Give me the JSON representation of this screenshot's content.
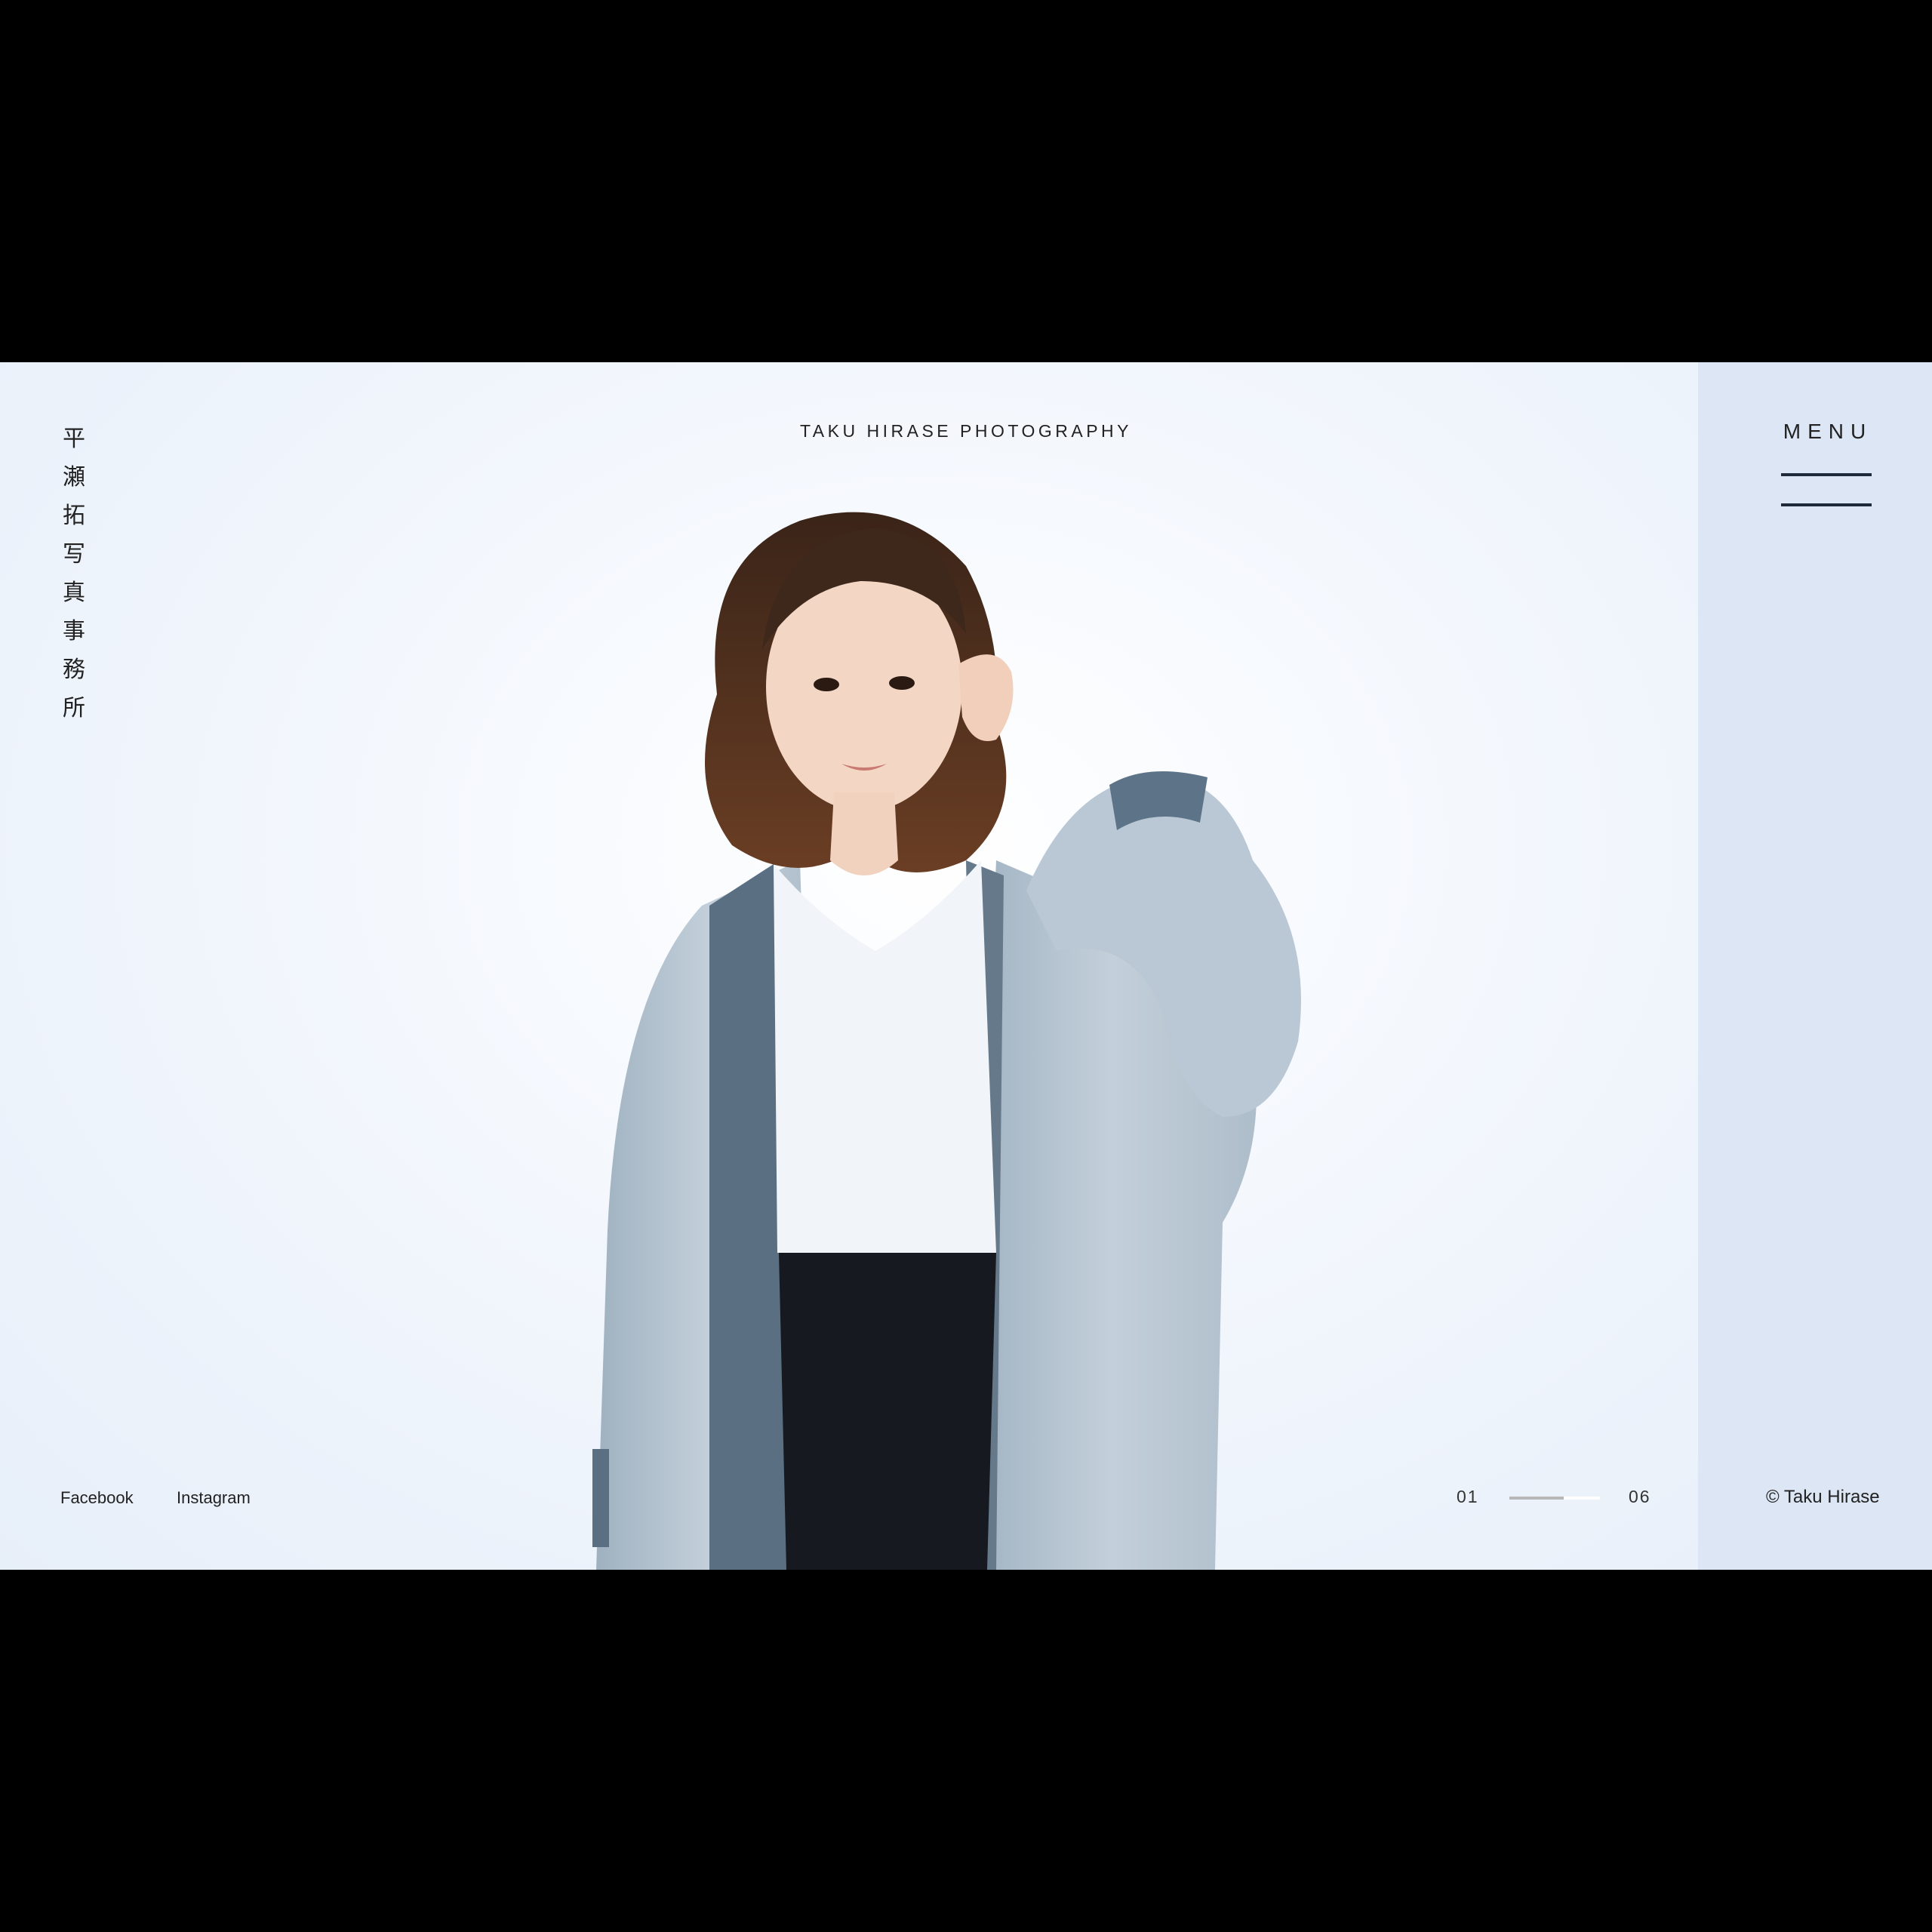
{
  "brand": {
    "logo_vertical": [
      "平",
      "瀬",
      "拓",
      "写",
      "真",
      "事",
      "務",
      "所"
    ],
    "site_title": "TAKU HIRASE PHOTOGRAPHY"
  },
  "menu": {
    "label": "MENU",
    "icon": "hamburger-icon"
  },
  "social_links": [
    {
      "label": "Facebook"
    },
    {
      "label": "Instagram"
    }
  ],
  "slider": {
    "current": "01",
    "total": "06",
    "progress": 0.6
  },
  "footer": {
    "copyright": "© Taku Hirase"
  },
  "colors": {
    "side_panel": "#dce6f5",
    "hero_background": "#eef4fb",
    "text": "#222222",
    "menu_bars": "#1e2a3a"
  }
}
